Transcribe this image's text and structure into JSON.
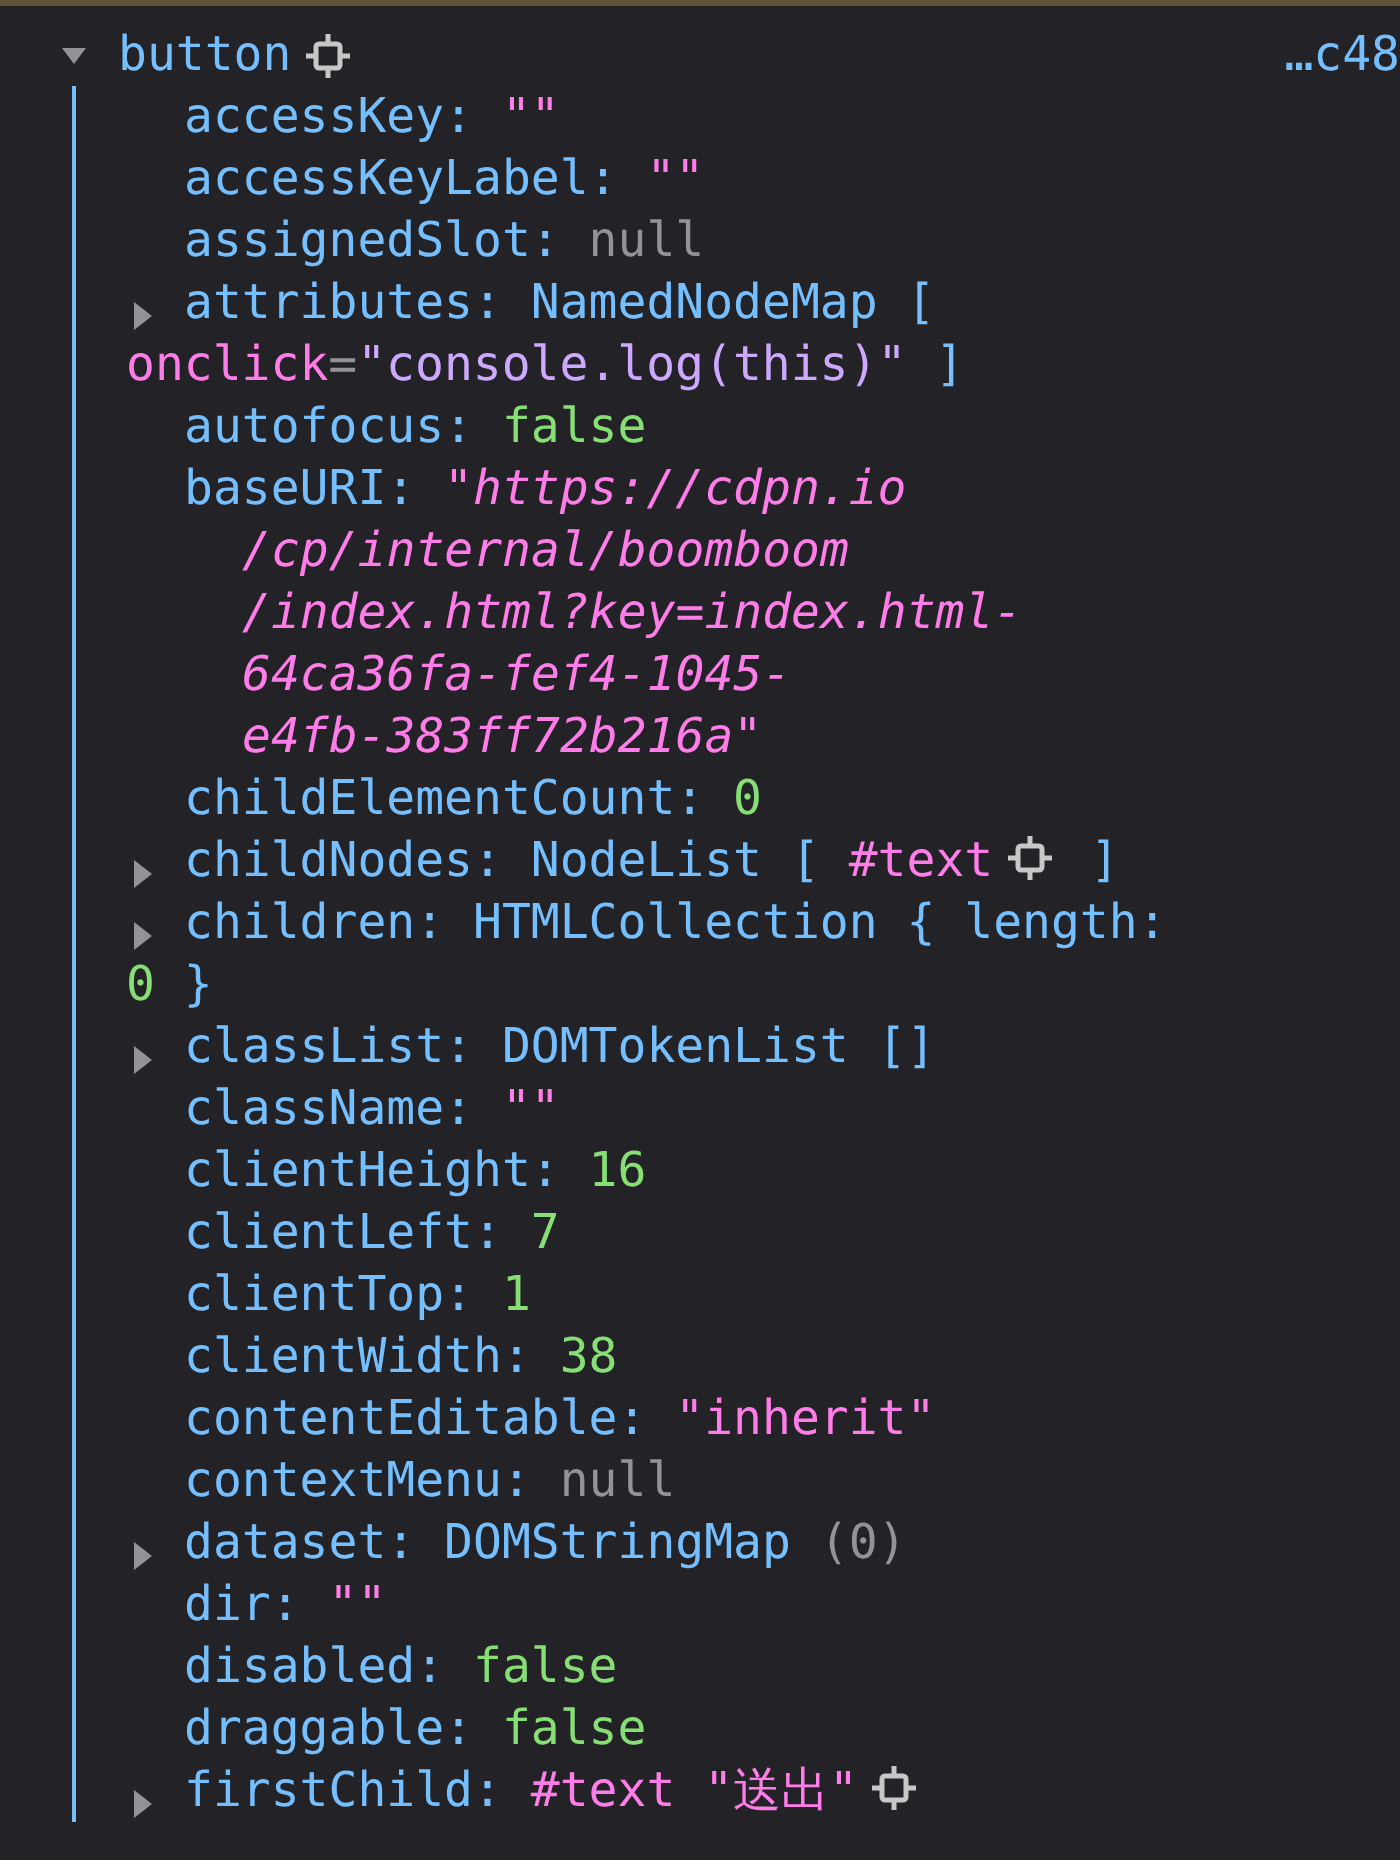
{
  "node": {
    "label": "button",
    "expanded": true,
    "inspect": true,
    "location": "…c48"
  },
  "properties": [
    {
      "key": "accessKey:",
      "expandable": false,
      "value": [
        {
          "kind": "string",
          "text": "\"\""
        }
      ]
    },
    {
      "key": "accessKeyLabel:",
      "expandable": false,
      "value": [
        {
          "kind": "string",
          "text": "\"\""
        }
      ]
    },
    {
      "key": "assignedSlot:",
      "expandable": false,
      "value": [
        {
          "kind": "null",
          "text": "null"
        }
      ]
    },
    {
      "key": "attributes:",
      "expandable": true,
      "value": [
        {
          "kind": "object",
          "text": "NamedNodeMap ["
        },
        {
          "kind": "attr",
          "name": "onclick",
          "eq": "=",
          "text": "\"console.log(this)\""
        },
        {
          "kind": "object",
          "text": "]"
        }
      ]
    },
    {
      "key": "autofocus:",
      "expandable": false,
      "value": [
        {
          "kind": "bool",
          "text": "false"
        }
      ]
    },
    {
      "key": "baseURI:",
      "expandable": false,
      "value": [
        {
          "kind": "url",
          "lines": [
            "\"https://cdpn.io",
            "/cp/internal/boomboom",
            "/index.html?key=index.html-",
            "64ca36fa-fef4-1045-",
            "e4fb-383ff72b216a\""
          ]
        }
      ]
    },
    {
      "key": "childElementCount:",
      "expandable": false,
      "value": [
        {
          "kind": "number",
          "text": "0"
        }
      ]
    },
    {
      "key": "childNodes:",
      "expandable": true,
      "value": [
        {
          "kind": "object",
          "text": "NodeList ["
        },
        {
          "kind": "node",
          "text": "#text",
          "inspect": true
        },
        {
          "kind": "object",
          "text": "]"
        }
      ]
    },
    {
      "key": "children:",
      "expandable": true,
      "value": [
        {
          "kind": "object",
          "text": "HTMLCollection { length:"
        },
        {
          "kind": "number",
          "text": "0"
        },
        {
          "kind": "object",
          "text": "}"
        }
      ]
    },
    {
      "key": "classList:",
      "expandable": true,
      "value": [
        {
          "kind": "object",
          "text": "DOMTokenList []"
        }
      ]
    },
    {
      "key": "className:",
      "expandable": false,
      "value": [
        {
          "kind": "string",
          "text": "\"\""
        }
      ]
    },
    {
      "key": "clientHeight:",
      "expandable": false,
      "value": [
        {
          "kind": "number",
          "text": "16"
        }
      ]
    },
    {
      "key": "clientLeft:",
      "expandable": false,
      "value": [
        {
          "kind": "number",
          "text": "7"
        }
      ]
    },
    {
      "key": "clientTop:",
      "expandable": false,
      "value": [
        {
          "kind": "number",
          "text": "1"
        }
      ]
    },
    {
      "key": "clientWidth:",
      "expandable": false,
      "value": [
        {
          "kind": "number",
          "text": "38"
        }
      ]
    },
    {
      "key": "contentEditable:",
      "expandable": false,
      "value": [
        {
          "kind": "string",
          "text": "\"inherit\""
        }
      ]
    },
    {
      "key": "contextMenu:",
      "expandable": false,
      "value": [
        {
          "kind": "null",
          "text": "null"
        }
      ]
    },
    {
      "key": "dataset:",
      "expandable": true,
      "value": [
        {
          "kind": "object",
          "text": "DOMStringMap"
        },
        {
          "kind": "count",
          "text": "(0)"
        }
      ]
    },
    {
      "key": "dir:",
      "expandable": false,
      "value": [
        {
          "kind": "string",
          "text": "\"\""
        }
      ]
    },
    {
      "key": "disabled:",
      "expandable": false,
      "value": [
        {
          "kind": "bool",
          "text": "false"
        }
      ]
    },
    {
      "key": "draggable:",
      "expandable": false,
      "value": [
        {
          "kind": "bool",
          "text": "false"
        }
      ]
    },
    {
      "key": "firstChild:",
      "expandable": true,
      "value": [
        {
          "kind": "node",
          "text": "#text"
        },
        {
          "kind": "string",
          "text": "\"送出\"",
          "inspect": true
        }
      ]
    }
  ]
}
